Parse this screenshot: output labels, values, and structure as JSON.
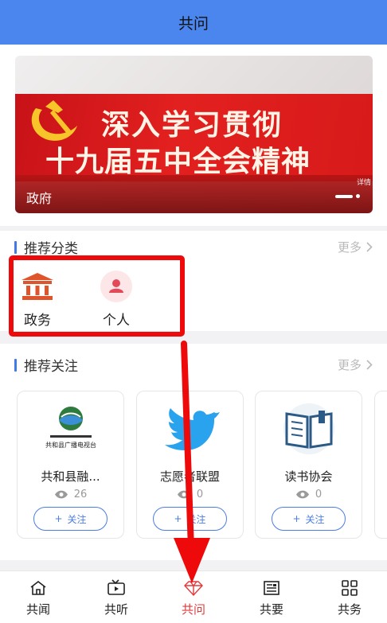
{
  "header": {
    "title": "共问"
  },
  "banner": {
    "headline_1": "深入学习贯彻",
    "headline_2": "十九届五中全会精神",
    "caption": "政府",
    "corner_tag": "详情"
  },
  "categories": {
    "title": "推荐分类",
    "more": "更多",
    "items": [
      {
        "label": "政务",
        "icon": "government-building-icon"
      },
      {
        "label": "个人",
        "icon": "person-icon"
      }
    ]
  },
  "follows": {
    "title": "推荐关注",
    "more": "更多",
    "follow_label": "关注",
    "follow_plus": "+",
    "cards": [
      {
        "name": "共和县融...",
        "fans": "26",
        "logo_text": "共和县广播电视台"
      },
      {
        "name": "志愿者联盟",
        "fans": "0"
      },
      {
        "name": "读书协会",
        "fans": "0"
      }
    ]
  },
  "tabbar": {
    "items": [
      {
        "label": "共闻",
        "icon": "home-icon",
        "active": false
      },
      {
        "label": "共听",
        "icon": "tv-play-icon",
        "active": false
      },
      {
        "label": "共问",
        "icon": "diamond-icon",
        "active": true
      },
      {
        "label": "共要",
        "icon": "newspaper-icon",
        "active": false
      },
      {
        "label": "共务",
        "icon": "grid-icon",
        "active": false
      }
    ]
  },
  "colors": {
    "header_bg": "#4a86ee",
    "accent_blue": "#3f7ae8",
    "highlight_red": "#ee0a0a",
    "active_tab": "#e23a3a"
  }
}
